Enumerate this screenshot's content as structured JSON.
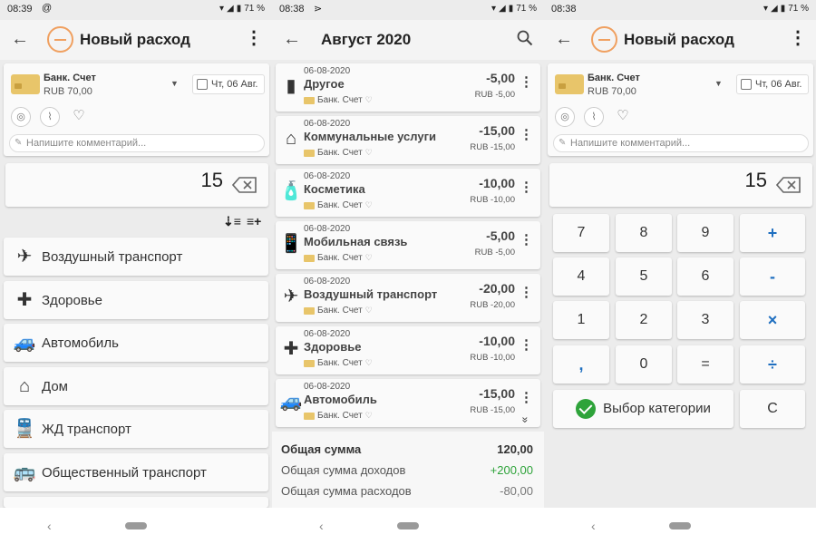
{
  "colors": {
    "accent_orange": "#f0a060",
    "operator_blue": "#1f6fc0",
    "income_green": "#2ea33a",
    "card_gold": "#e8c56a"
  },
  "status": {
    "p1": {
      "time": "08:39",
      "icon": "@",
      "battery": "71 %"
    },
    "p2": {
      "time": "08:38",
      "icon": "⋗",
      "battery": "71 %"
    },
    "p3": {
      "time": "08:38",
      "icon": "",
      "battery": "71 %"
    }
  },
  "new_expense": {
    "title": "Новый расход",
    "account_name": "Банк. Счет",
    "account_balance": "RUB 70,00",
    "date": "Чт, 06 Авг.",
    "comment_placeholder": "Напишите комментарий...",
    "amount": "15"
  },
  "categories": [
    {
      "label": "Воздушный транспорт",
      "icon": "airplane-icon",
      "glyph": "✈"
    },
    {
      "label": "Здоровье",
      "icon": "medical-kit-icon",
      "glyph": "✚"
    },
    {
      "label": "Автомобиль",
      "icon": "car-icon",
      "glyph": "🚙"
    },
    {
      "label": "Дом",
      "icon": "house-icon",
      "glyph": "⌂"
    },
    {
      "label": "ЖД транспорт",
      "icon": "train-icon",
      "glyph": "🚆"
    },
    {
      "label": "Общественный транспорт",
      "icon": "bus-icon",
      "glyph": "🚌"
    }
  ],
  "history": {
    "title": "Август 2020",
    "transactions": [
      {
        "date": "06-08-2020",
        "name": "Другое",
        "account": "Банк. Счет",
        "amount": "-5,00",
        "sub": "RUB  -5,00",
        "icon": "folder-icon",
        "glyph": "▮"
      },
      {
        "date": "06-08-2020",
        "name": "Коммунальные услуги",
        "account": "Банк. Счет",
        "amount": "-15,00",
        "sub": "RUB  -15,00",
        "icon": "utilities-house-icon",
        "glyph": "⌂"
      },
      {
        "date": "06-08-2020",
        "name": "Косметика",
        "account": "Банк. Счет",
        "amount": "-10,00",
        "sub": "RUB  -10,00",
        "icon": "cosmetics-icon",
        "glyph": "🧴"
      },
      {
        "date": "06-08-2020",
        "name": "Мобильная связь",
        "account": "Банк. Счет",
        "amount": "-5,00",
        "sub": "RUB  -5,00",
        "icon": "mobile-phone-icon",
        "glyph": "📱"
      },
      {
        "date": "06-08-2020",
        "name": "Воздушный транспорт",
        "account": "Банк. Счет",
        "amount": "-20,00",
        "sub": "RUB  -20,00",
        "icon": "airplane-icon",
        "glyph": "✈"
      },
      {
        "date": "06-08-2020",
        "name": "Здоровье",
        "account": "Банк. Счет",
        "amount": "-10,00",
        "sub": "RUB  -10,00",
        "icon": "medical-kit-icon",
        "glyph": "✚"
      },
      {
        "date": "06-08-2020",
        "name": "Автомобиль",
        "account": "Банк. Счет",
        "amount": "-15,00",
        "sub": "RUB  -15,00",
        "icon": "car-icon",
        "glyph": "🚙"
      }
    ],
    "summary": {
      "total_label": "Общая сумма",
      "total_value": "120,00",
      "income_label": "Общая сумма доходов",
      "income_value": "+200,00",
      "expense_label": "Общая сумма расходов",
      "expense_value": "-80,00"
    }
  },
  "keypad": {
    "keys": [
      "7",
      "8",
      "9",
      "+",
      "4",
      "5",
      "6",
      "-",
      "1",
      "2",
      "3",
      "×",
      ",",
      "0",
      "=",
      "÷"
    ],
    "choose_category": "Выбор категории",
    "clear": "C"
  },
  "glyphs": {
    "back": "←",
    "kebab": "⋮",
    "caret": "▼",
    "chevron_down": "»",
    "nav_back": "‹"
  }
}
